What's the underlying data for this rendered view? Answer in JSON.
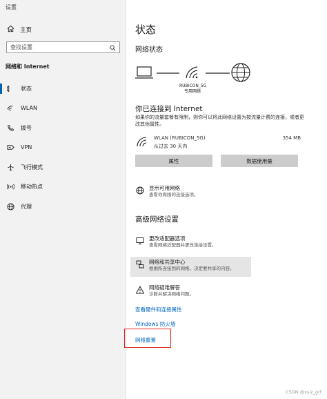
{
  "window": {
    "title": "设置"
  },
  "sidebar": {
    "home_label": "主页",
    "search_placeholder": "查找设置",
    "section_label": "网络和 Internet",
    "items": [
      {
        "label": "状态",
        "icon": "home-status-icon",
        "active": true
      },
      {
        "label": "WLAN",
        "icon": "wifi-icon"
      },
      {
        "label": "拨号",
        "icon": "phone-icon"
      },
      {
        "label": "VPN",
        "icon": "vpn-icon"
      },
      {
        "label": "飞行模式",
        "icon": "airplane-icon"
      },
      {
        "label": "移动热点",
        "icon": "hotspot-icon"
      },
      {
        "label": "代理",
        "icon": "globe-icon"
      }
    ]
  },
  "main": {
    "title": "状态",
    "network_status_label": "网络状态",
    "network_name": "RUBICON_5G",
    "network_type": "专用网络",
    "connected_title": "你已连接到 Internet",
    "connected_desc": "如果你的流量套餐有限制，则你可以将此网络设置为按流量计费的连接，或者更改其他属性。",
    "wlan": {
      "name": "WLAN (RUBICON_5G)",
      "duration": "从过去 30 天内",
      "usage": "354 MB"
    },
    "buttons": {
      "properties": "属性",
      "data_usage": "数据使用量"
    },
    "available": {
      "title": "显示可用网络",
      "desc": "查看你周围的连接选项。"
    },
    "advanced_title": "高级网络设置",
    "adapter": {
      "title": "更改适配器选项",
      "desc": "查看网络适配器并更改连接设置。"
    },
    "sharing": {
      "title": "网络和共享中心",
      "desc": "根据所连接到的网络，决定要共享的内容。"
    },
    "troubleshoot": {
      "title": "网络疑难解答",
      "desc": "诊断并解决网络问题。"
    },
    "links": {
      "hardware": "查看硬件和连接属性",
      "firewall": "Windows 防火墙",
      "reset": "网络重置"
    }
  },
  "watermark": "CSDN @xslz_grf",
  "colors": {
    "accent": "#0063b1",
    "link": "#0067c0",
    "highlight": "#e0201b",
    "sidebar_bg": "#f2f2f2"
  }
}
